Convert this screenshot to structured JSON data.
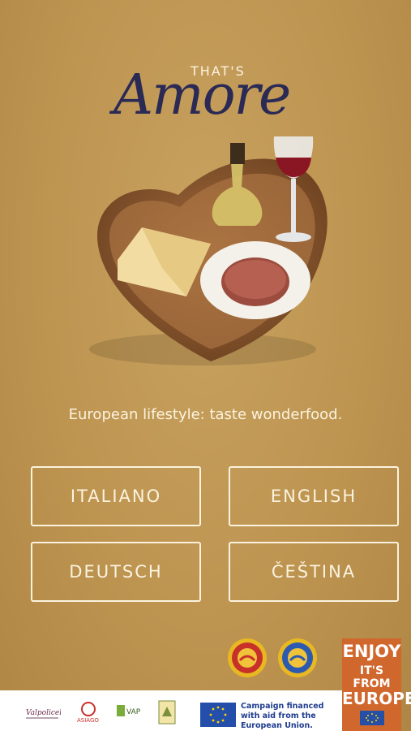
{
  "logo": {
    "top_text": "THAT'S",
    "script_text": "Amore"
  },
  "tagline": "European lifestyle: taste wonderfood.",
  "languages": {
    "italiano": "ITALIANO",
    "english": "ENGLISH",
    "deutsch": "DEUTSCH",
    "cestina": "ČEŠTINA"
  },
  "badge": {
    "line1": "ENJOY",
    "line2": "IT'S FROM",
    "line3": "EUROPE"
  },
  "footer": {
    "campaign_text": "Campaign financed with aid from the European Union."
  },
  "colors": {
    "background": "#bd9450",
    "text_light": "#fbf3df",
    "logo_dark": "#2a2a55",
    "badge_orange": "#d0672c",
    "eu_blue": "#234eaa"
  }
}
